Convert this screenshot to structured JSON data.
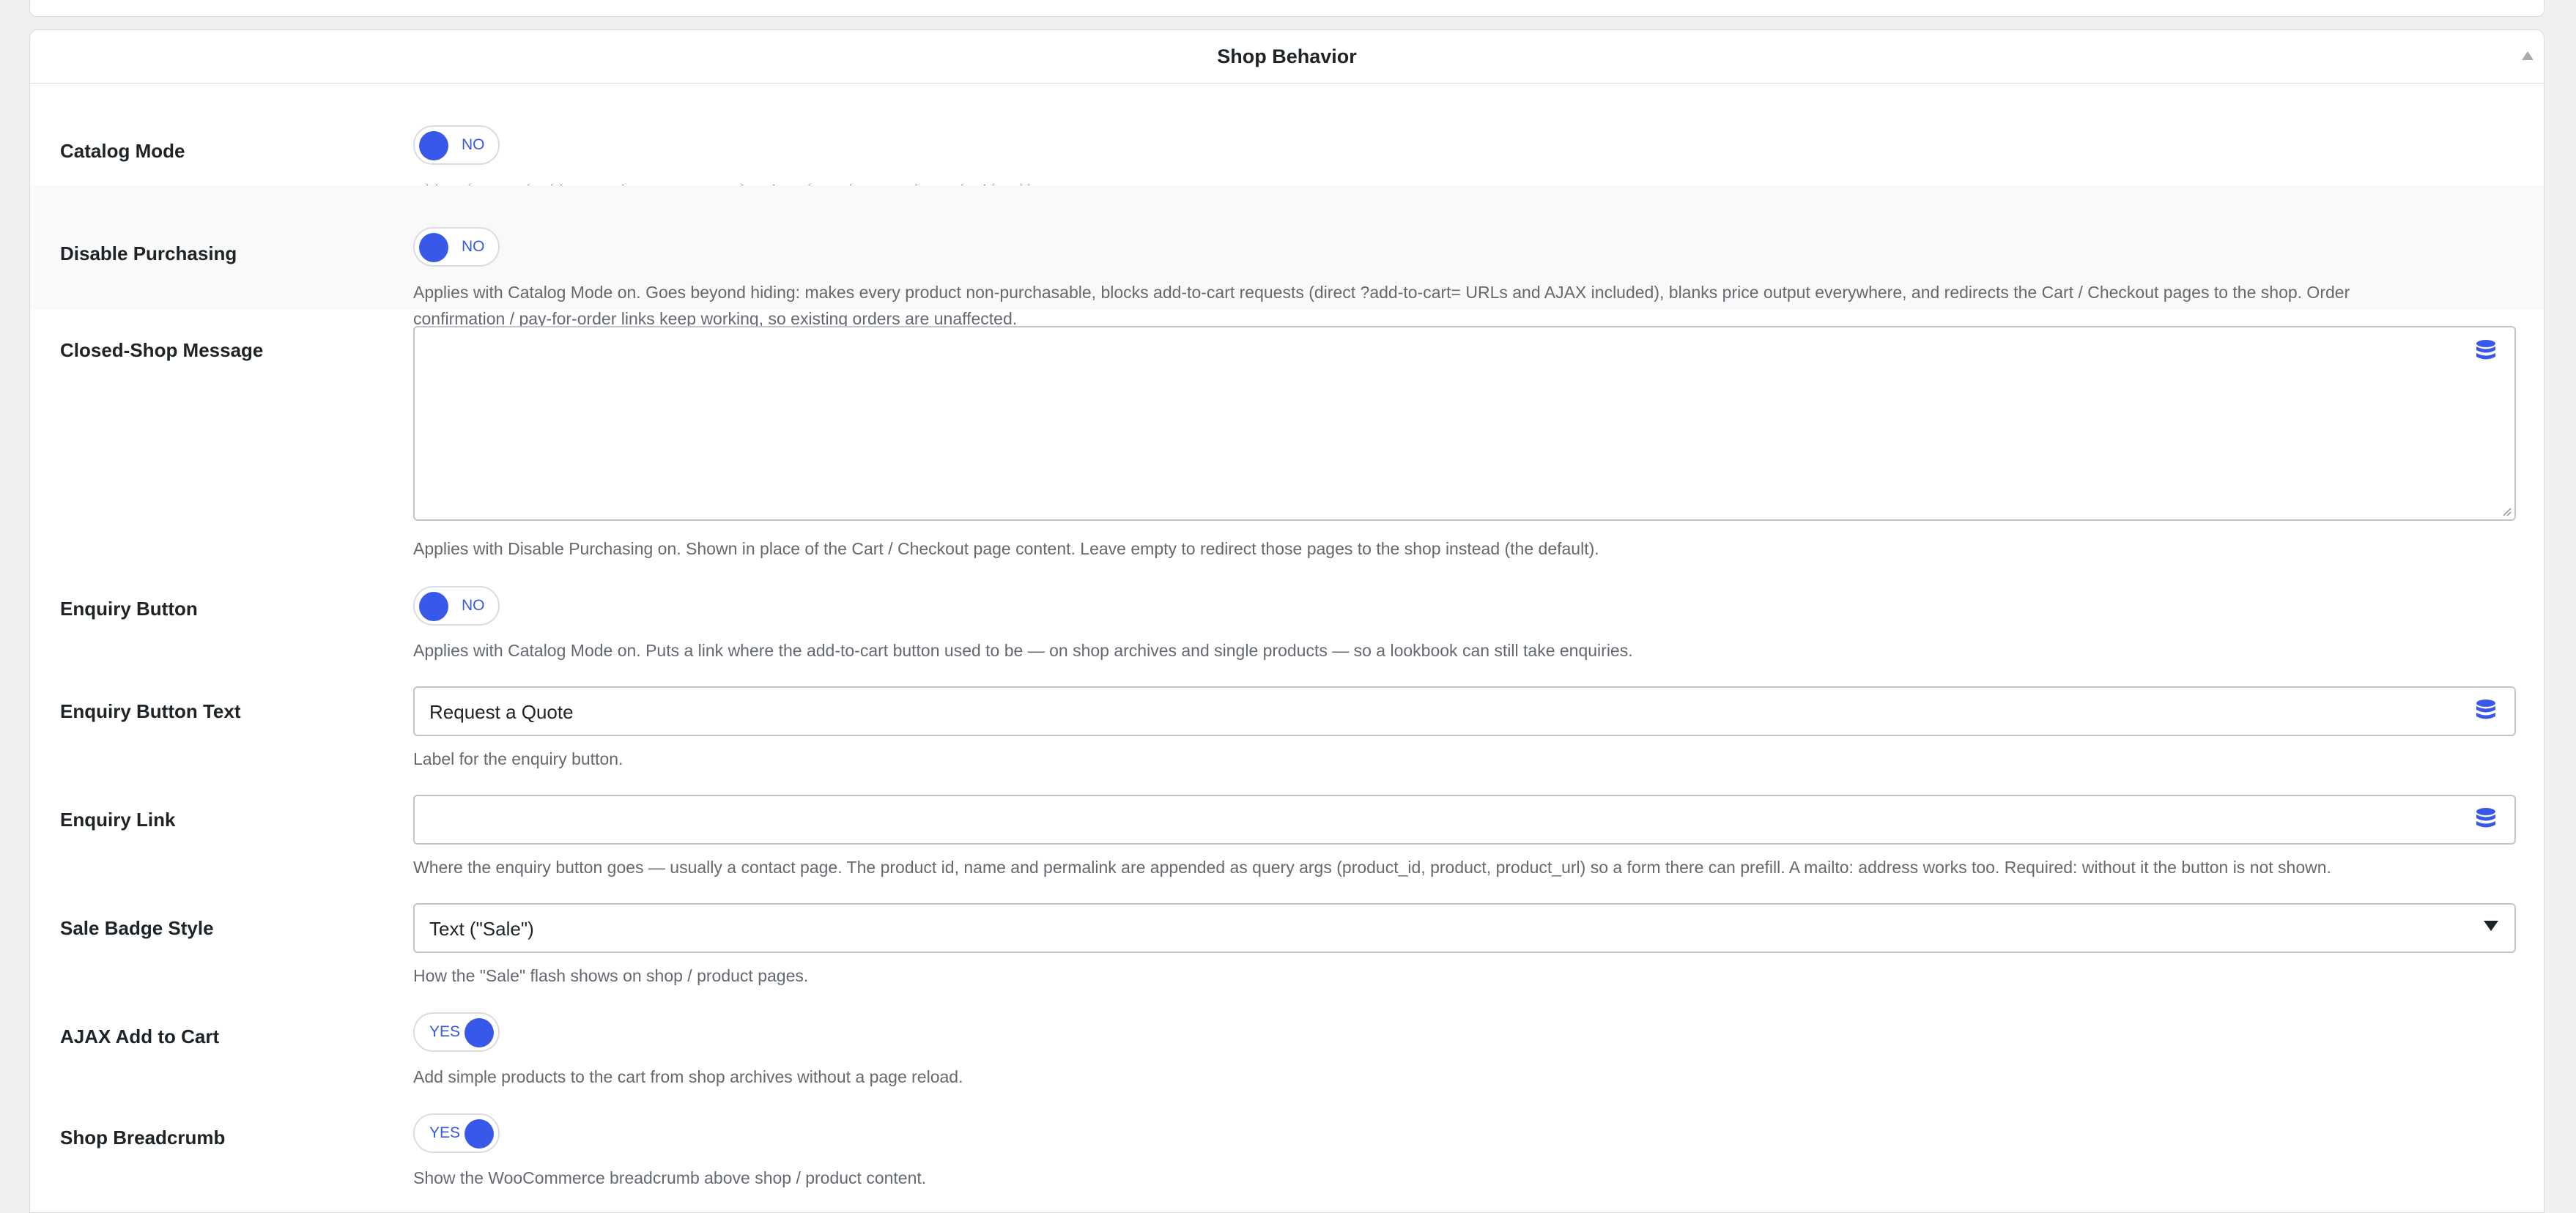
{
  "panel": {
    "title": "Shop Behavior",
    "collapse_icon": "triangle-up-icon"
  },
  "settings": {
    "catalog_mode": {
      "label": "Catalog Mode",
      "toggle_text": "NO",
      "value": false,
      "description": "Hide prices and add-to-cart buttons across the shop (turn the store into a lookbook)."
    },
    "disable_purchasing": {
      "label": "Disable Purchasing",
      "toggle_text": "NO",
      "value": false,
      "description_line1": "Applies with Catalog Mode on. Goes beyond hiding: makes every product non-purchasable, blocks add-to-cart requests (direct ?add-to-cart= URLs and AJAX included), blanks price output everywhere, and redirects the Cart / Checkout pages to the shop. Order",
      "description_line2": "confirmation / pay-for-order links keep working, so existing orders are unaffected."
    },
    "closed_shop_message": {
      "label": "Closed-Shop Message",
      "value": "",
      "description": "Applies with Disable Purchasing on. Shown in place of the Cart / Checkout page content. Leave empty to redirect those pages to the shop instead (the default)."
    },
    "enquiry_button": {
      "label": "Enquiry Button",
      "toggle_text": "NO",
      "value": false,
      "description": "Applies with Catalog Mode on. Puts a link where the add-to-cart button used to be — on shop archives and single products — so a lookbook can still take enquiries."
    },
    "enquiry_button_text": {
      "label": "Enquiry Button Text",
      "value": "Request a Quote",
      "description": "Label for the enquiry button."
    },
    "enquiry_link": {
      "label": "Enquiry Link",
      "value": "",
      "description": "Where the enquiry button goes — usually a contact page. The product id, name and permalink are appended as query args (product_id, product, product_url) so a form there can prefill. A mailto: address works too. Required: without it the button is not shown."
    },
    "sale_badge_style": {
      "label": "Sale Badge Style",
      "selected": "Text (\"Sale\")",
      "description": "How the \"Sale\" flash shows on shop / product pages."
    },
    "ajax_add_to_cart": {
      "label": "AJAX Add to Cart",
      "toggle_text": "YES",
      "value": true,
      "description": "Add simple products to the cart from shop archives without a page reload."
    },
    "shop_breadcrumb": {
      "label": "Shop Breadcrumb",
      "toggle_text": "YES",
      "value": true,
      "description": "Show the WooCommerce breadcrumb above shop / product content."
    }
  },
  "icons": {
    "database": "database-icon",
    "dropdown": "caret-down-icon"
  },
  "colors": {
    "accent": "#3858e9",
    "text": "#1d2327",
    "muted": "#646970",
    "border": "#c3c4c7",
    "background": "#f0f0f1"
  }
}
